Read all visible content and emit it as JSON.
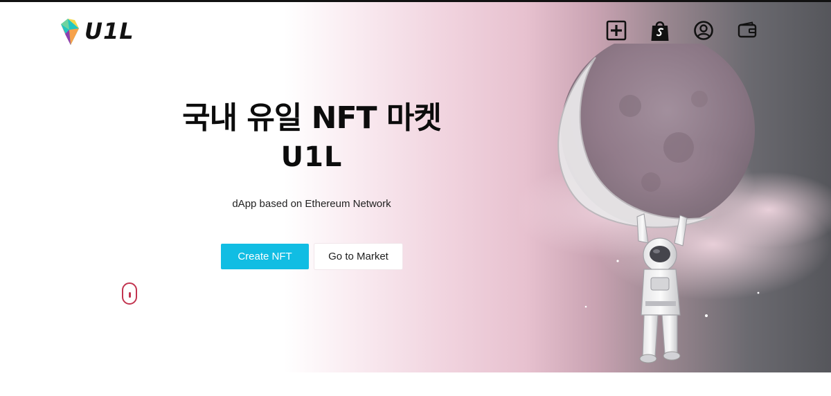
{
  "header": {
    "logo_text": "U1L",
    "icons": [
      "plus-square-icon",
      "shopping-bag-icon",
      "user-circle-icon",
      "wallet-icon"
    ]
  },
  "hero": {
    "headline_line1": "국내 유일 NFT 마켓",
    "headline_line2": "U1L",
    "subtitle": "dApp based on Ethereum Network",
    "create_button": "Create NFT",
    "market_button": "Go to Market"
  },
  "colors": {
    "primary_button": "#11bde3",
    "scroll_indicator": "#c2344f",
    "headline_text": "#0c0c0c",
    "hero_gradient_start": "#ffffff",
    "hero_gradient_mid": "#e7c1cf",
    "hero_gradient_end": "#55565b"
  },
  "illustration": {
    "icon": "astronaut-holding-moon-icon"
  }
}
